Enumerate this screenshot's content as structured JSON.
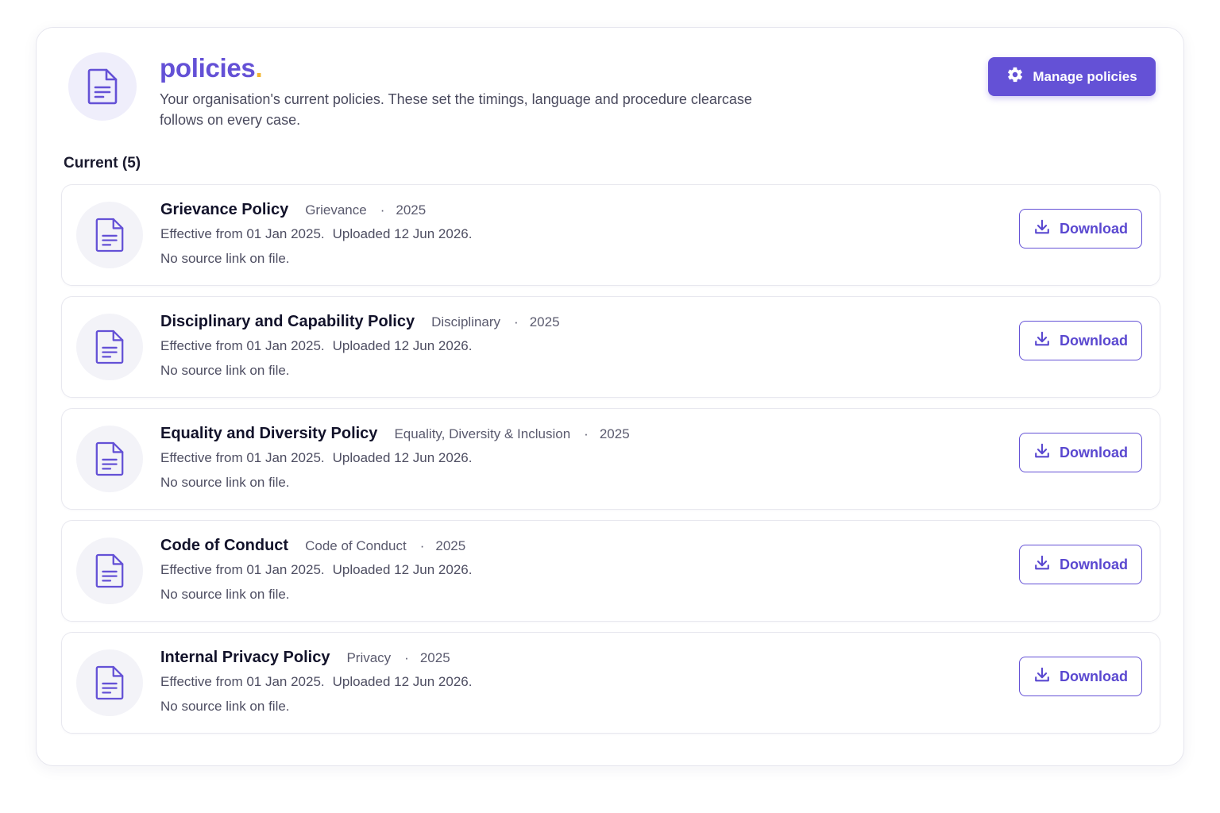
{
  "header": {
    "title": "policies",
    "title_dot": ".",
    "subtitle": "Your organisation's current policies. These set the timings, language and procedure clearcase follows on every case.",
    "manage_label": "Manage policies",
    "icon": "document-icon",
    "manage_icon": "gear-icon"
  },
  "section": {
    "label": "Current (5)"
  },
  "policies": [
    {
      "name": "Grievance Policy",
      "category": "Grievance",
      "separator": "·",
      "year": "2025",
      "effective": "Effective from 01 Jan 2025.",
      "uploaded": "Uploaded 12 Jun 2026.",
      "source": "No source link on file.",
      "download_label": "Download"
    },
    {
      "name": "Disciplinary and Capability Policy",
      "category": "Disciplinary",
      "separator": "·",
      "year": "2025",
      "effective": "Effective from 01 Jan 2025.",
      "uploaded": "Uploaded 12 Jun 2026.",
      "source": "No source link on file.",
      "download_label": "Download"
    },
    {
      "name": "Equality and Diversity Policy",
      "category": "Equality, Diversity & Inclusion",
      "separator": "·",
      "year": "2025",
      "effective": "Effective from 01 Jan 2025.",
      "uploaded": "Uploaded 12 Jun 2026.",
      "source": "No source link on file.",
      "download_label": "Download"
    },
    {
      "name": "Code of Conduct",
      "category": "Code of Conduct",
      "separator": "·",
      "year": "2025",
      "effective": "Effective from 01 Jan 2025.",
      "uploaded": "Uploaded 12 Jun 2026.",
      "source": "No source link on file.",
      "download_label": "Download"
    },
    {
      "name": "Internal Privacy Policy",
      "category": "Privacy",
      "separator": "·",
      "year": "2025",
      "effective": "Effective from 01 Jan 2025.",
      "uploaded": "Uploaded 12 Jun 2026.",
      "source": "No source link on file.",
      "download_label": "Download"
    }
  ],
  "colors": {
    "accent": "#6451d6",
    "title_dot": "#f2b630",
    "icon_bg": "#efeefb"
  }
}
